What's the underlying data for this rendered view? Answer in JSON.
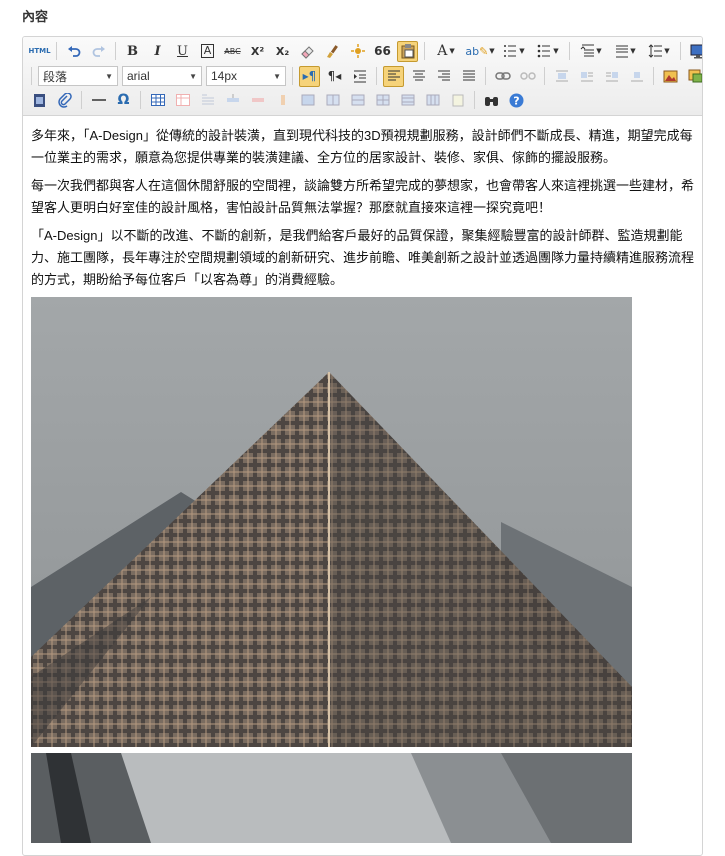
{
  "section": {
    "title": "內容"
  },
  "toolbar": {
    "html_label": "HTML",
    "bold": "B",
    "italic": "I",
    "underline": "U",
    "font_border": "A",
    "strike": "ABC",
    "superscript": "X²",
    "subscript": "X₂",
    "quote": "66",
    "font_color": "A",
    "omega": "Ω",
    "format_block": {
      "value": "段落"
    },
    "font_family": {
      "value": "arial"
    },
    "font_size": {
      "value": "14px"
    },
    "icons": [
      "html-icon",
      "undo-icon",
      "redo-icon",
      "bold-icon",
      "italic-icon",
      "underline-icon",
      "font-border-icon",
      "strikethrough-icon",
      "superscript-icon",
      "subscript-icon",
      "eraser-icon",
      "format-brush-icon",
      "auto-format-icon",
      "blockquote-icon",
      "paste-plain-icon",
      "font-color-icon",
      "highlight-icon",
      "ordered-list-icon",
      "unordered-list-icon",
      "row-spacing-top-icon",
      "row-spacing-bottom-icon",
      "line-height-icon",
      "preview-icon",
      "ltr-icon",
      "rtl-icon",
      "indent-icon",
      "align-left-icon",
      "align-center-icon",
      "align-right-icon",
      "align-justify-icon",
      "link-icon",
      "unlink-icon",
      "image-none-icon",
      "image-left-icon",
      "image-right-icon",
      "image-center-icon",
      "image-icon",
      "insert-image-icon",
      "video-icon",
      "attachment-icon",
      "horizontal-rule-icon",
      "special-char-icon",
      "table-icon",
      "search-replace-icon",
      "help-icon"
    ]
  },
  "content": {
    "paragraphs": [
      "多年來，「A-Design」從傳統的設計裝潢，直到現代科技的3D預視規劃服務，設計師們不斷成長、精進，期望完成每一位業主的需求，願意為您提供專業的裝潢建議、全方位的居家設計、裝修、家俱、傢飾的擺設服務。",
      "每一次我們都與客人在這個休閒舒服的空間裡，談論雙方所希望完成的夢想家，也會帶客人來這裡挑選一些建材，希望客人更明白好室佳的設計風格，害怕設計品質無法掌握？那麼就直接來這裡一探究竟吧！",
      "「A-Design」以不斷的改進、不斷的創新，是我們給客戶最好的品質保證，聚集經驗豐富的設計師群、監造規劃能力、施工團隊，長年專注於空間規劃領域的創新研究、進步前瞻、唯美創新之設計並透過團隊力量持續精進服務流程的方式，期盼給予每位客戶「以客為尊」的消費經驗。"
    ]
  }
}
